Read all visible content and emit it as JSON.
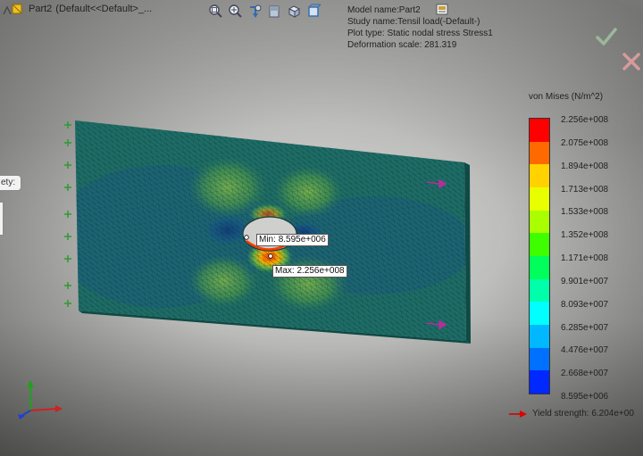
{
  "feature_tree": {
    "part_label": "Part2",
    "config_label": "(Default<<Default>_..."
  },
  "hud_toolbar": [
    {
      "name": "zoom-to-fit-icon"
    },
    {
      "name": "zoom-to-area-icon"
    },
    {
      "name": "previous-view-icon"
    },
    {
      "name": "section-view-icon"
    },
    {
      "name": "view-orientation-icon"
    },
    {
      "name": "display-style-icon"
    }
  ],
  "study": {
    "model_name": "Model name:Part2",
    "study_name": "Study name:Tensil load(-Default-)",
    "plot_type": "Plot type: Static nodal stress Stress1",
    "deformation_scale": "Deformation scale: 281.319"
  },
  "left_flyout": {
    "label": "ety:"
  },
  "probes": {
    "min": {
      "label": "Min:",
      "value": "8.595e+006"
    },
    "max": {
      "label": "Max:",
      "value": "2.256e+008"
    }
  },
  "legend": {
    "title": "von Mises (N/m^2)",
    "labels": [
      "2.256e+008",
      "2.075e+008",
      "1.894e+008",
      "1.713e+008",
      "1.533e+008",
      "1.352e+008",
      "1.171e+008",
      "9.901e+007",
      "8.093e+007",
      "6.285e+007",
      "4.476e+007",
      "2.668e+007",
      "8.595e+006"
    ],
    "colors": [
      "#ff0000",
      "#ff6a00",
      "#ffd200",
      "#e8ff00",
      "#a9ff00",
      "#3dff00",
      "#00ff5a",
      "#00ffaa",
      "#00ffff",
      "#00b8ff",
      "#0070ff",
      "#0028ff",
      "#0000e0"
    ],
    "yield_label": "Yield strength: 6.204e+00"
  },
  "colors": {
    "mesh_body": "#1e6e68",
    "hole": "#c9c9c9"
  }
}
